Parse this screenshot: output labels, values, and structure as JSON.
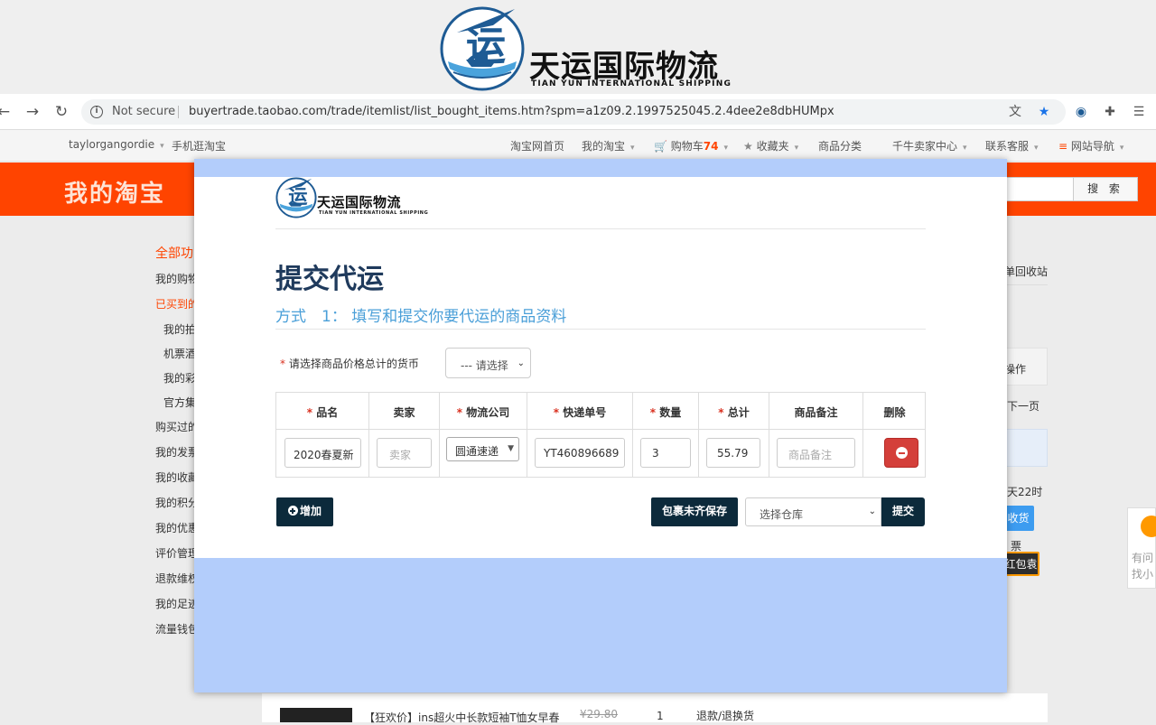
{
  "banner": {
    "name_cn": "天运国际物流",
    "name_en": "TIAN YUN INTERNATIONAL SHIPPING",
    "logo_glyph": "运"
  },
  "browser": {
    "security_label": "Not secure",
    "url": "buyertrade.taobao.com/trade/itemlist/list_bought_items.htm?spm=a1z09.2.1997525045.2.4dee2e8dbHUMpx",
    "icons": [
      "back-icon",
      "forward-icon",
      "reload-icon",
      "info-icon",
      "translate-icon",
      "star-icon",
      "extension-icon",
      "puzzle-icon",
      "reading-list-icon"
    ]
  },
  "taobao_header": {
    "user": "taylorgangordie",
    "mobile": "手机逛淘宝",
    "home": "淘宝网首页",
    "my_taobao": "我的淘宝",
    "cart_label": "购物车",
    "cart_count": "74",
    "favorites": "收藏夹",
    "categories": "商品分类",
    "seller_center": "千牛卖家中心",
    "service": "联系客服",
    "site_nav": "网站导航"
  },
  "taobao_band": {
    "title": "我的淘宝",
    "search_button": "搜 索"
  },
  "left_nav": {
    "items": [
      {
        "label": "全部功",
        "style": "big"
      },
      {
        "label": "我的购物",
        "style": ""
      },
      {
        "label": "已买到的",
        "style": "red"
      },
      {
        "label": "我的拍",
        "style": "sub"
      },
      {
        "label": "机票酒",
        "style": "sub"
      },
      {
        "label": "我的彩",
        "style": "sub"
      },
      {
        "label": "官方集",
        "style": "sub"
      },
      {
        "label": "购买过的",
        "style": ""
      },
      {
        "label": "我的发票",
        "style": ""
      },
      {
        "label": "我的收藏",
        "style": ""
      },
      {
        "label": "我的积分",
        "style": ""
      },
      {
        "label": "我的优惠",
        "style": ""
      },
      {
        "label": "评价管理",
        "style": ""
      },
      {
        "label": "退款维权",
        "style": ""
      },
      {
        "label": "我的足迹",
        "style": ""
      },
      {
        "label": "流量钱包",
        "style": ""
      }
    ]
  },
  "right_side": {
    "recycle": "单回收站",
    "operation": "操作",
    "next_page": "下一页",
    "time_text": "天22时",
    "confirm": "收货",
    "invoice": "票",
    "gift": "红包袁",
    "help_1": "有问",
    "help_2": "找小"
  },
  "order_row": {
    "title": "【狂欢价】ins超火中长款短袖T恤女早春",
    "price": "¥29.80",
    "qty": "1",
    "status": "退款/退换货"
  },
  "modal": {
    "logo_name": "天运国际物流",
    "logo_sub": "TIAN YUN INTERNATIONAL SHIPPING",
    "title": "提交代运",
    "subtitle": "方式　1：  填写和提交你要代运的商品资料",
    "currency_label": "请选择商品价格总计的货币",
    "currency_select": "--- 请选择",
    "required_mark": "*",
    "columns": [
      "品名",
      "卖家",
      "物流公司",
      "快递单号",
      "数量",
      "总计",
      "商品备注",
      "删除"
    ],
    "required_columns": [
      true,
      false,
      true,
      true,
      true,
      true,
      false,
      false
    ],
    "row": {
      "item_name": "2020春夏新",
      "seller_placeholder": "卖家",
      "courier": "圆通速递",
      "tracking_no": "YT460896689",
      "quantity": "3",
      "total": "55.79",
      "remark_placeholder": "商品备注"
    },
    "add_button": "增加",
    "save_button": "包裹未齐保存",
    "warehouse_select": "选择仓库",
    "submit_button": "提交"
  },
  "colors": {
    "taobao_orange": "#ff4400",
    "modal_backdrop": "#b3cdfb",
    "title_navy": "#1f3a5c",
    "subtitle_blue": "#4a9fd8",
    "button_dark": "#0c2a3b",
    "danger_red": "#d43f3a"
  }
}
